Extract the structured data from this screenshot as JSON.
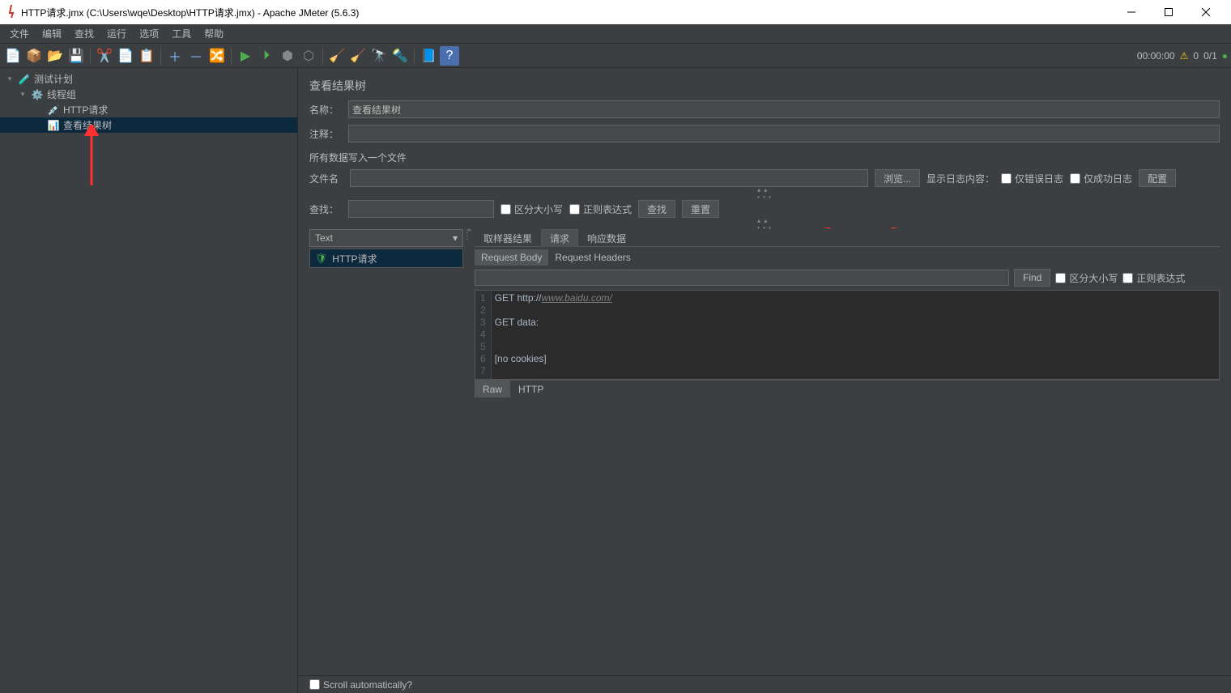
{
  "title": "HTTP请求.jmx (C:\\Users\\wqe\\Desktop\\HTTP请求.jmx) - Apache JMeter (5.6.3)",
  "menu": [
    "文件",
    "编辑",
    "查找",
    "运行",
    "选项",
    "工具",
    "帮助"
  ],
  "toolbar_right": {
    "time": "00:00:00",
    "count1": "0",
    "count2": "0/1"
  },
  "tree": {
    "root": "测试计划",
    "thread_group": "线程组",
    "http_request": "HTTP请求",
    "results_tree": "查看结果树"
  },
  "panel": {
    "title": "查看结果树",
    "name_label": "名称：",
    "name_value": "查看结果树",
    "comment_label": "注释：",
    "comment_value": "",
    "write_section": "所有数据写入一个文件",
    "filename_label": "文件名",
    "filename_value": "",
    "browse_btn": "浏览...",
    "show_log_label": "显示日志内容：",
    "only_err": "仅错误日志",
    "only_ok": "仅成功日志",
    "configure_btn": "配置",
    "search_label": "查找：",
    "search_value": "",
    "case_sens": "区分大小写",
    "regex": "正则表达式",
    "search_btn": "查找",
    "reset_btn": "重置",
    "dropdown": "Text",
    "result_item": "HTTP请求",
    "tabs": {
      "sampler": "取样器结果",
      "request": "请求",
      "response": "响应数据"
    },
    "subtabs": {
      "body": "Request Body",
      "headers": "Request Headers"
    },
    "find_btn": "Find",
    "find_case": "区分大小写",
    "find_regex": "正则表达式",
    "code_lines": [
      "GET http://",
      "",
      "GET data:",
      "",
      "",
      "[no cookies]",
      ""
    ],
    "code_url": "www.baidu.com/",
    "bottom_tabs": {
      "raw": "Raw",
      "http": "HTTP"
    },
    "scroll_auto": "Scroll automatically?"
  }
}
